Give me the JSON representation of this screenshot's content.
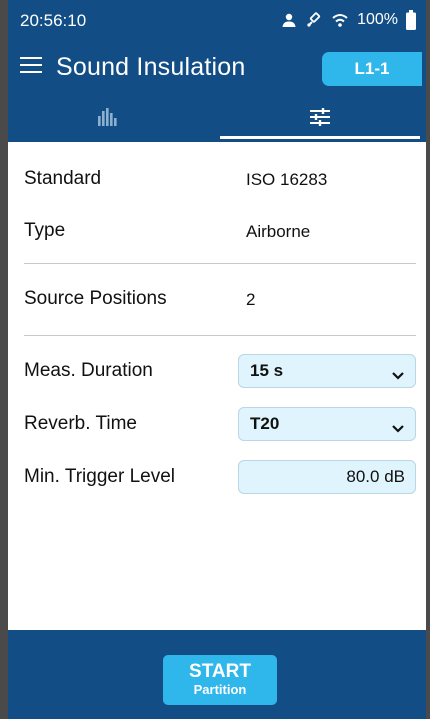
{
  "status": {
    "time": "20:56:10",
    "battery_pct": "100%",
    "icons": [
      "person-icon",
      "satellite-icon",
      "wifi-icon",
      "battery-icon"
    ]
  },
  "header": {
    "title": "Sound Insulation",
    "location_badge": "L1-1",
    "menu_icon": "hamburger-icon"
  },
  "tabs": [
    {
      "icon": "bar-chart-icon",
      "active": false
    },
    {
      "icon": "sliders-icon",
      "active": true
    }
  ],
  "settings": {
    "standard": {
      "label": "Standard",
      "value": "ISO 16283"
    },
    "type": {
      "label": "Type",
      "value": "Airborne"
    },
    "source_positions": {
      "label": "Source Positions",
      "value": "2"
    },
    "meas_duration": {
      "label": "Meas. Duration",
      "value": "15 s"
    },
    "reverb_time": {
      "label": "Reverb. Time",
      "value": "T20"
    },
    "min_trigger": {
      "label": "Min. Trigger Level",
      "value": "80.0 dB"
    }
  },
  "footer": {
    "start_label": "START",
    "start_sublabel": "Partition"
  },
  "colors": {
    "primary": "#124e85",
    "accent": "#2fb6ea",
    "field_bg": "#dff4fc"
  }
}
